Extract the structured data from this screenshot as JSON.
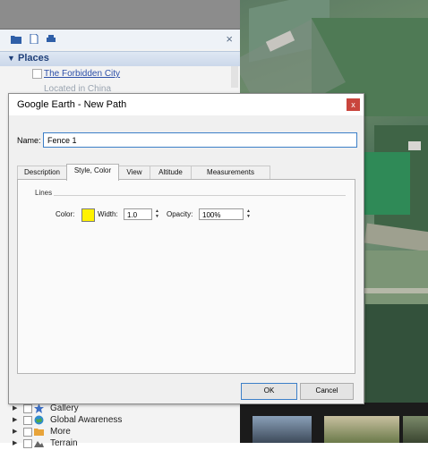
{
  "places_panel": {
    "header": "Places",
    "item_link": "The Forbidden City",
    "item_sub": "Located in China",
    "tree": [
      {
        "label": "Gallery",
        "icon": "gallery-icon"
      },
      {
        "label": "Global Awareness",
        "icon": "globe-icon"
      },
      {
        "label": "More",
        "icon": "folder-icon"
      },
      {
        "label": "Terrain",
        "icon": "terrain-icon"
      }
    ]
  },
  "dialog": {
    "title": "Google Earth - New Path",
    "close_glyph": "x",
    "name_label": "Name:",
    "name_value": "Fence 1",
    "tabs": [
      "Description",
      "Style, Color",
      "View",
      "Altitude",
      "Measurements"
    ],
    "active_tab": "Style, Color",
    "group_label": "Lines",
    "color_label": "Color:",
    "color_value": "#fff200",
    "width_label": "Width:",
    "width_value": "1.0",
    "opacity_label": "Opacity:",
    "opacity_value": "100%",
    "ok_label": "OK",
    "cancel_label": "Cancel"
  },
  "colors": {
    "accent": "#3c7fc8",
    "close_red": "#c9453d",
    "places_header_text": "#1f3f79"
  }
}
